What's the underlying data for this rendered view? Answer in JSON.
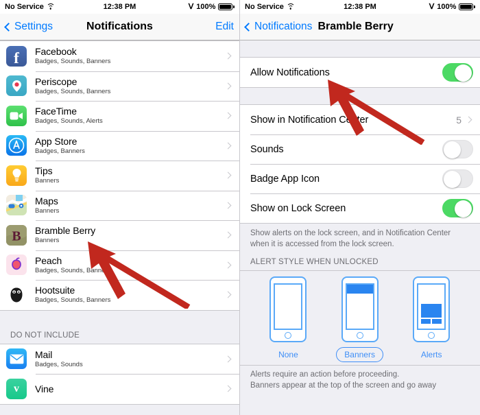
{
  "status_bar": {
    "carrier": "No Service",
    "time": "12:38 PM",
    "battery_percent": "100%",
    "wifi_icon": "wifi-icon",
    "bluetooth_icon": "bluetooth-icon",
    "battery_icon": "battery-full-icon"
  },
  "left_screen": {
    "nav": {
      "back_label": "Settings",
      "title": "Notifications",
      "edit_label": "Edit",
      "back_icon": "chevron-left-icon"
    },
    "included_apps": [
      {
        "name": "Facebook",
        "detail": "Badges, Sounds, Banners",
        "icon": "facebook-icon"
      },
      {
        "name": "Periscope",
        "detail": "Badges, Sounds, Banners",
        "icon": "periscope-icon"
      },
      {
        "name": "FaceTime",
        "detail": "Badges, Sounds, Alerts",
        "icon": "facetime-icon"
      },
      {
        "name": "App Store",
        "detail": "Badges, Banners",
        "icon": "app-store-icon"
      },
      {
        "name": "Tips",
        "detail": "Banners",
        "icon": "tips-icon"
      },
      {
        "name": "Maps",
        "detail": "Banners",
        "icon": "maps-icon"
      },
      {
        "name": "Bramble Berry",
        "detail": "Banners",
        "icon": "bramble-berry-icon"
      },
      {
        "name": "Peach",
        "detail": "Badges, Sounds, Banners",
        "icon": "peach-icon"
      },
      {
        "name": "Hootsuite",
        "detail": "Badges, Sounds, Banners",
        "icon": "hootsuite-icon"
      }
    ],
    "do_not_include_header": "DO NOT INCLUDE",
    "excluded_apps": [
      {
        "name": "Mail",
        "detail": "Badges, Sounds",
        "icon": "mail-icon"
      },
      {
        "name": "Vine",
        "detail": "",
        "icon": "vine-icon"
      }
    ]
  },
  "right_screen": {
    "nav": {
      "back_label": "Notifications",
      "title": "Bramble Berry",
      "back_icon": "chevron-left-icon"
    },
    "allow_notifications": {
      "label": "Allow Notifications",
      "enabled": true
    },
    "options": [
      {
        "label": "Show in Notification Center",
        "type": "value",
        "value": "5"
      },
      {
        "label": "Sounds",
        "type": "toggle",
        "enabled": false
      },
      {
        "label": "Badge App Icon",
        "type": "toggle",
        "enabled": false
      },
      {
        "label": "Show on Lock Screen",
        "type": "toggle",
        "enabled": true
      }
    ],
    "lock_screen_footnote": "Show alerts on the lock screen, and in Notification Center when it is accessed from the lock screen.",
    "alert_style_header": "ALERT STYLE WHEN UNLOCKED",
    "alert_styles": [
      {
        "label": "None",
        "selected": false
      },
      {
        "label": "Banners",
        "selected": true
      },
      {
        "label": "Alerts",
        "selected": false
      }
    ],
    "alert_style_footnote_line1": "Alerts require an action before proceeding.",
    "alert_style_footnote_line2": "Banners appear at the top of the screen and go away"
  },
  "annotations": {
    "arrow_color": "#c1281e",
    "arrow_left_target": "Bramble Berry",
    "arrow_right_target": "Allow Notifications"
  },
  "colors": {
    "tint": "#007aff",
    "toggle_on": "#4cd964",
    "group_bg": "#efeff4",
    "separator": "#c8c7cc",
    "picker_blue": "#3e8ef7"
  }
}
